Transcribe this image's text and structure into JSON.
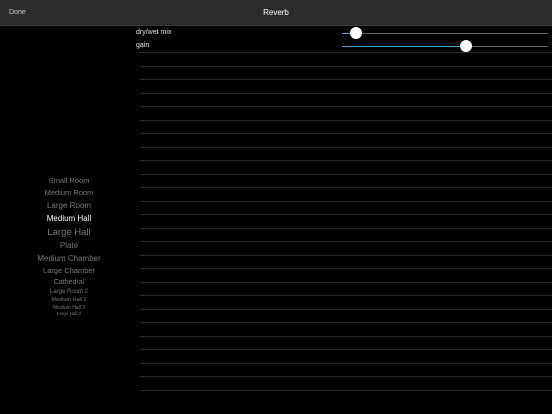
{
  "navbar": {
    "done_label": "Done",
    "title": "Reverb"
  },
  "presets": {
    "items": [
      {
        "label": "Small Room"
      },
      {
        "label": "Medium Room"
      },
      {
        "label": "Large Room"
      },
      {
        "label": "Medium Hall"
      },
      {
        "label": "Large Hall"
      },
      {
        "label": "Plate"
      },
      {
        "label": "Medium Chamber"
      },
      {
        "label": "Large Chamber"
      },
      {
        "label": "Cathedral"
      },
      {
        "label": "Large Room 2"
      },
      {
        "label": "Medium Hall 2"
      },
      {
        "label": "Medium Hall 3"
      },
      {
        "label": "Large Hall 2"
      }
    ],
    "selected": "Medium Hall"
  },
  "params": {
    "items": [
      {
        "label": "dry/wet mix",
        "value": 0.07
      },
      {
        "label": "gain",
        "value": 0.6
      }
    ]
  },
  "colors": {
    "background": "#000000",
    "navbar": "#2b2b2b",
    "accent": "#3aa7d6",
    "picker_selected": "#ffffff",
    "picker_normal": "#7a7a7a"
  }
}
